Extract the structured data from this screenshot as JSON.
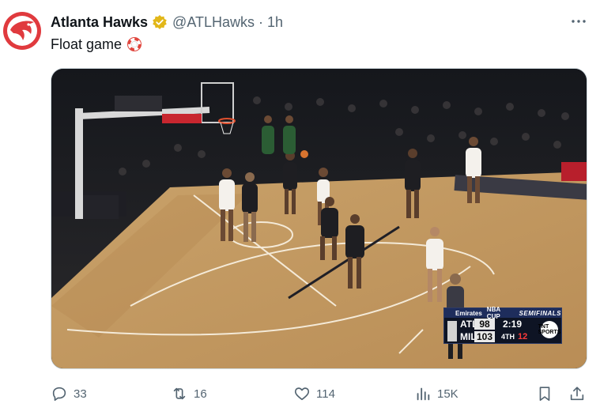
{
  "tweet": {
    "author_name": "Atlanta Hawks",
    "handle": "@ATLHawks",
    "separator": "·",
    "time": "1h",
    "text": "Float game",
    "text_emoji": "lifebuoy-icon",
    "verified_color": "#e2b719",
    "brand_color": "#e03a3e"
  },
  "scoreboard": {
    "sponsor": "Emirates",
    "cup": "NBA CUP",
    "stage": "SEMIFINALS",
    "teams": [
      {
        "abbr": "ATL",
        "score": "98"
      },
      {
        "abbr": "MIL",
        "score": "103"
      }
    ],
    "clock": "2:19",
    "quarter": "4TH",
    "shot_clock": "12",
    "network": "TNT SPORTS"
  },
  "actions": {
    "replies": "33",
    "reposts": "16",
    "likes": "114",
    "views": "15K"
  }
}
